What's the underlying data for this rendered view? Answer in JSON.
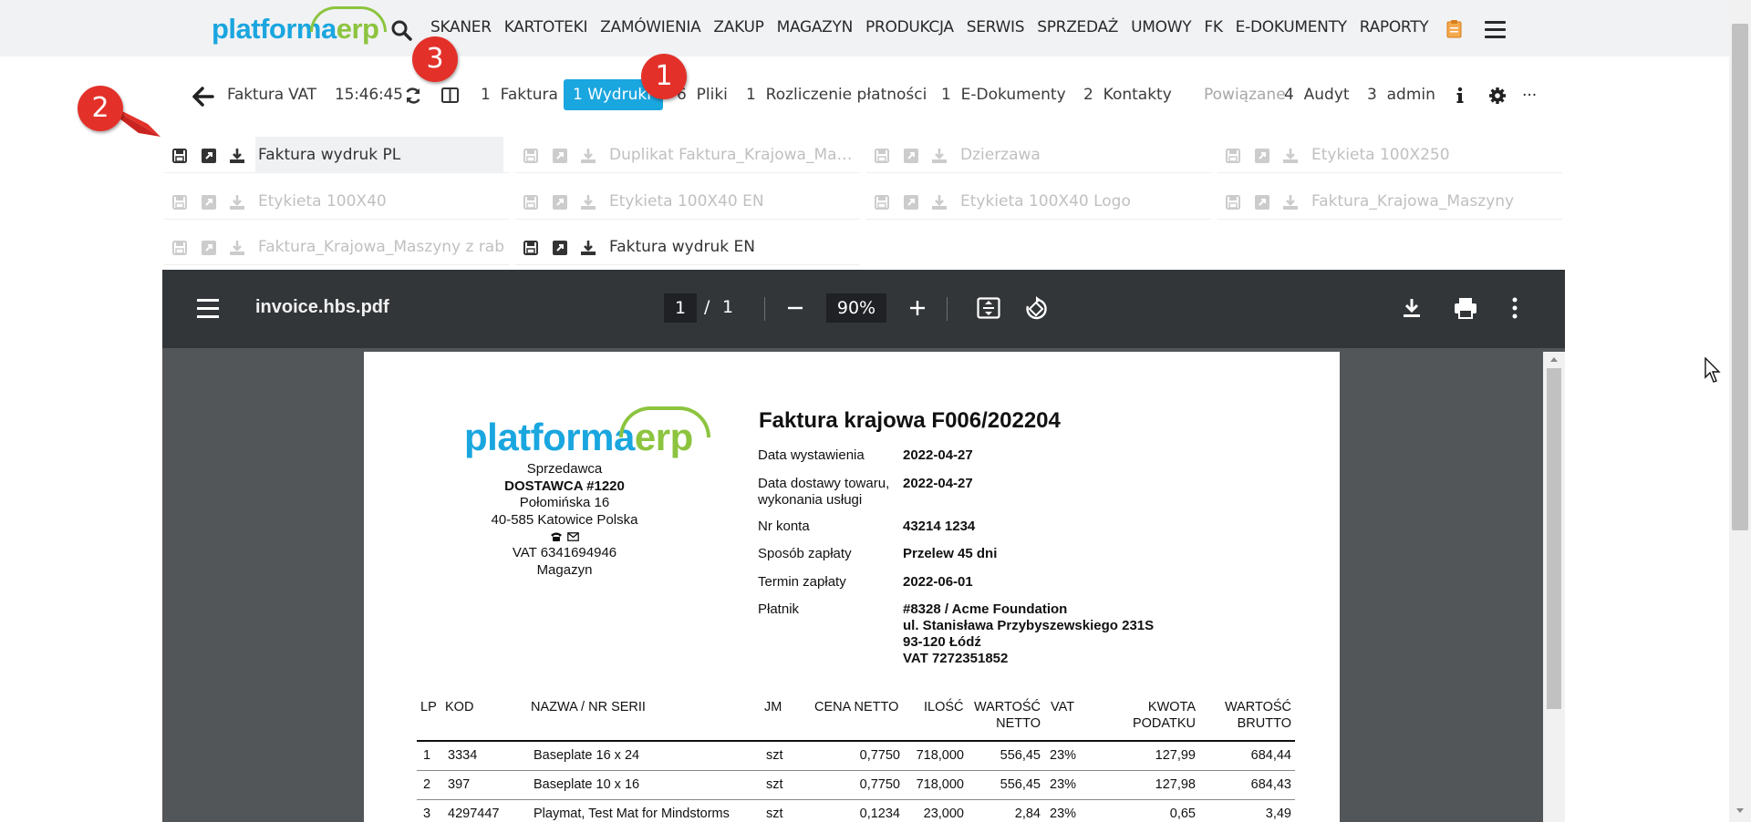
{
  "brand": {
    "part1": "platforma",
    "part2": "erp"
  },
  "main_menu": [
    "SKANER",
    "KARTOTEKI",
    "ZAMÓWIENIA",
    "ZAKUP",
    "MAGAZYN",
    "PRODUKCJA",
    "SERWIS",
    "SPRZEDAŻ",
    "UMOWY",
    "FK",
    "E-DOKUMENTY",
    "RAPORTY"
  ],
  "subnav": {
    "doc_type": "Faktura VAT",
    "time": "15:46:45",
    "tabs": [
      {
        "count": "1",
        "label": "Faktura"
      },
      {
        "count": "1",
        "label": "Wydruki"
      },
      {
        "count": "6",
        "label": "Pliki"
      },
      {
        "count": "1",
        "label": "Rozliczenie płatności"
      },
      {
        "count": "1",
        "label": "E-Dokumenty"
      },
      {
        "count": "2",
        "label": "Kontakty"
      },
      {
        "count": "",
        "label": "Powiązane"
      },
      {
        "count": "4",
        "label": "Audyt"
      },
      {
        "count": "3",
        "label": "admin"
      }
    ],
    "more": "..."
  },
  "badges": [
    "1",
    "2",
    "3"
  ],
  "prints": [
    {
      "label": "Faktura wydruk PL",
      "state": "active"
    },
    {
      "label": "Duplikat Faktura_Krajowa_Maszyny",
      "state": "disabled"
    },
    {
      "label": "Dzierzawa",
      "state": "disabled"
    },
    {
      "label": "Etykieta 100X250",
      "state": "disabled"
    },
    {
      "label": "Etykieta 100X40",
      "state": "disabled"
    },
    {
      "label": "Etykieta 100X40 EN",
      "state": "disabled"
    },
    {
      "label": "Etykieta 100X40 Logo",
      "state": "disabled"
    },
    {
      "label": "Faktura_Krajowa_Maszyny",
      "state": "disabled"
    },
    {
      "label": "Faktura_Krajowa_Maszyny z rabatem",
      "state": "disabled"
    },
    {
      "label": "Faktura wydruk EN",
      "state": "enabled"
    }
  ],
  "pdf": {
    "filename": "invoice.hbs.pdf",
    "page": "1",
    "page_sep": "/",
    "page_total": "1",
    "zoom": "90%"
  },
  "invoice": {
    "title": "Faktura krajowa F006/202204",
    "seller": {
      "heading": "Sprzedawca",
      "name": "DOSTAWCA #1220",
      "street": "Połomińska 16",
      "city": "40-585 Katowice Polska",
      "vat": "VAT 6341694946",
      "warehouse": "Magazyn"
    },
    "fields": [
      {
        "label": "Data wystawienia",
        "value": "2022-04-27"
      },
      {
        "label": "Data dostawy towaru, wykonania usługi",
        "value": "2022-04-27"
      },
      {
        "label": "Nr konta",
        "value": "43214 1234"
      },
      {
        "label": "Sposób zapłaty",
        "value": "Przelew 45 dni"
      },
      {
        "label": "Termin zapłaty",
        "value": "2022-06-01"
      },
      {
        "label": "Płatnik",
        "value": "#8328 / Acme Foundation"
      }
    ],
    "payer_lines": [
      "ul. Stanisława Przybyszewskiego 231S",
      "93-120 Łódź",
      "VAT 7272351852"
    ],
    "headers": [
      "LP",
      "KOD",
      "NAZWA / NR SERII",
      "JM",
      "CENA NETTO",
      "ILOŚĆ",
      "WARTOŚĆ NETTO",
      "VAT",
      "KWOTA PODATKU",
      "WARTOŚĆ BRUTTO"
    ],
    "rows": [
      [
        "1",
        "3334",
        "Baseplate 16 x 24",
        "szt",
        "0,7750",
        "718,000",
        "556,45",
        "23%",
        "127,99",
        "684,44"
      ],
      [
        "2",
        "397",
        "Baseplate 10 x 16",
        "szt",
        "0,7750",
        "718,000",
        "556,45",
        "23%",
        "127,98",
        "684,43"
      ],
      [
        "3",
        "4297447",
        "Playmat, Test Mat for Mindstorms",
        "szt",
        "0,1234",
        "23,000",
        "2,84",
        "23%",
        "0,65",
        "3,49"
      ]
    ]
  }
}
